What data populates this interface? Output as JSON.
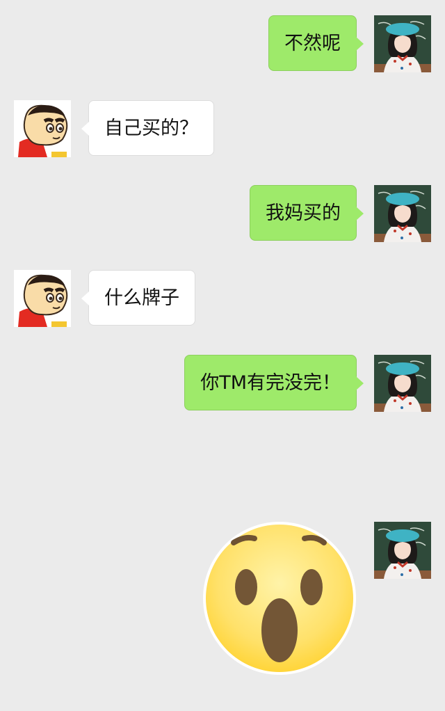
{
  "messages": [
    {
      "side": "me",
      "text": "不然呢"
    },
    {
      "side": "them",
      "text": "自己买的？"
    },
    {
      "side": "me",
      "text": "我妈买的"
    },
    {
      "side": "them",
      "text": "什么牌子"
    },
    {
      "side": "me",
      "text": "你TM有完没完！"
    },
    {
      "side": "me",
      "type": "sticker",
      "icon": "surprised-face-emoji"
    }
  ],
  "colors": {
    "background": "#ebebeb",
    "my_bubble": "#9eea6a",
    "their_bubble": "#ffffff"
  }
}
